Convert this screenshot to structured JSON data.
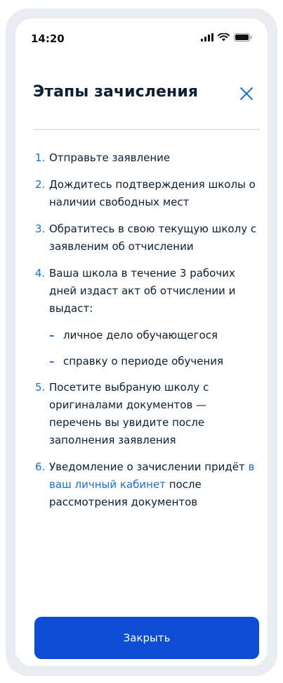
{
  "status_bar": {
    "time": "14:20",
    "icons": [
      "signal-icon",
      "wifi-icon",
      "battery-icon"
    ]
  },
  "header": {
    "title": "Этапы зачисления",
    "close_icon": "close-icon"
  },
  "steps": [
    {
      "number": "1.",
      "text": "Отправьте заявление"
    },
    {
      "number": "2.",
      "text": "Дождитесь подтверждения школы о наличии свободных мест"
    },
    {
      "number": "3.",
      "text": "Обратитесь в свою текущую школу с заявленим об отчислении"
    },
    {
      "number": "4.",
      "text": "Ваша школа в течение 3 рабочих дней издаст акт об отчислении и выдаст:",
      "subitems": [
        {
          "dash": "–",
          "text": "личное дело обучающегося"
        },
        {
          "dash": "–",
          "text": "справку о периоде обучения"
        }
      ]
    },
    {
      "number": "5.",
      "text": "Посетите выбраную школу с оригиналами документов — перечень вы увидите после заполнения заявления"
    },
    {
      "number": "6.",
      "text_before": "Уведомление о зачислении придёт ",
      "link": "в ваш личный кабинет",
      "text_after": " после рассмотрения документов"
    }
  ],
  "footer": {
    "close_button_label": "Закрыть"
  },
  "colors": {
    "accent": "#1a6fd8",
    "primary_button": "#0d4cd3",
    "text": "#0b1f33"
  }
}
